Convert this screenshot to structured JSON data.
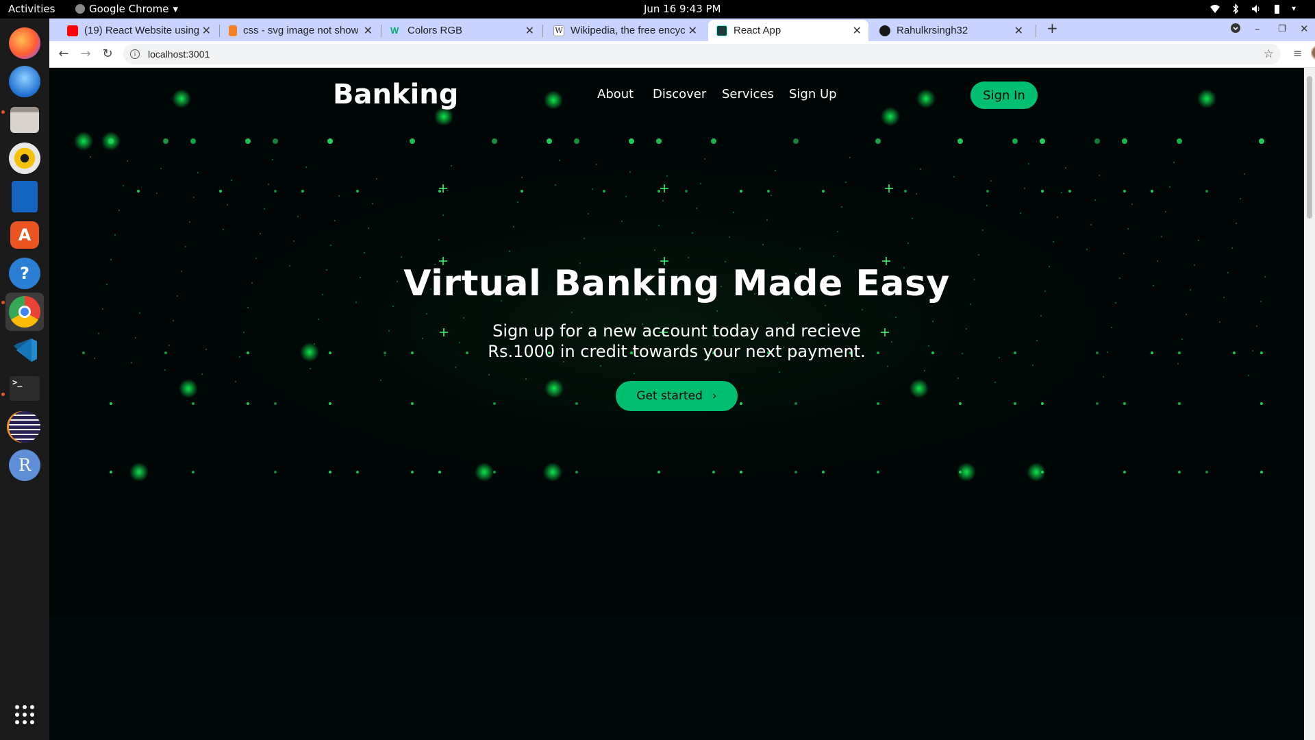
{
  "topbar": {
    "activities": "Activities",
    "app_name": "Google Chrome",
    "clock": "Jun 16  9:43 PM"
  },
  "dock": {
    "items": [
      "firefox-icon",
      "thunderbird-icon",
      "files-icon",
      "rhythmbox-icon",
      "writer-icon",
      "software-icon",
      "help-icon",
      "chrome-icon",
      "vscode-icon",
      "terminal-icon",
      "eclipse-icon",
      "r-icon",
      "apps-grid-icon"
    ]
  },
  "browser": {
    "tabs": [
      {
        "title": "(19) React Website using",
        "favicon_color": "#ff0000"
      },
      {
        "title": "css - svg image not showi",
        "favicon_color": "#f48024"
      },
      {
        "title": "Colors RGB",
        "favicon_color": "#04aa6d"
      },
      {
        "title": "Wikipedia, the free encycl",
        "favicon_color": "#ffffff"
      },
      {
        "title": "React App",
        "favicon_color": "#1e3a3a"
      },
      {
        "title": "Rahulkrsingh32",
        "favicon_color": "#181717"
      }
    ],
    "url": "localhost:3001"
  },
  "site": {
    "logo": "Banking",
    "nav": [
      "About",
      "Discover",
      "Services",
      "Sign Up"
    ],
    "signin": "Sign In",
    "hero_title": "Virtual Banking Made Easy",
    "hero_subtitle": "Sign up for a new account today and recieve Rs.1000 in credit towards your next payment.",
    "cta": "Get started",
    "accent_color": "#01bf71"
  }
}
